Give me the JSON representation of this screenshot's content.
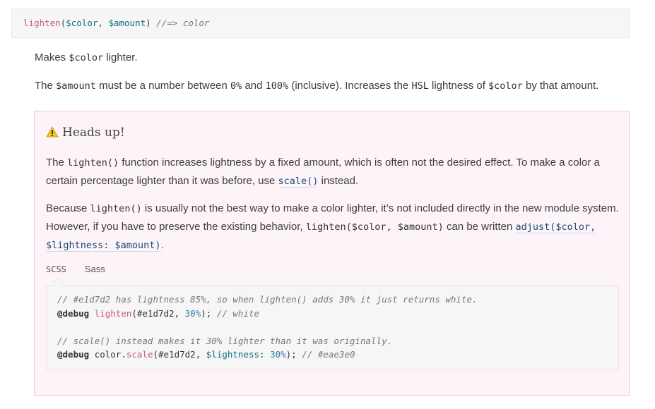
{
  "signature": {
    "fn": "lighten",
    "arg1": "$color",
    "arg2": "$amount",
    "returns": "//=> color"
  },
  "intro": {
    "p1_text": "Makes ",
    "p1_code": "$color",
    "p1_end": " lighter.",
    "p2": [
      {
        "t": "The "
      },
      {
        "c": "$amount"
      },
      {
        "t": " must be a number between "
      },
      {
        "c": "0%"
      },
      {
        "t": " and "
      },
      {
        "c": "100%"
      },
      {
        "t": " (inclusive). Increases the "
      },
      {
        "c": "HSL"
      },
      {
        "t": " lightness of "
      },
      {
        "c": "$color"
      },
      {
        "t": " by that amount."
      }
    ]
  },
  "callout": {
    "icon": "warning-icon",
    "title": "Heads up!",
    "para1": {
      "a": "The ",
      "code": "lighten()",
      "b": " function increases lightness by a fixed amount, which is often not the desired effect. To make a color a certain percentage lighter than it was before, use ",
      "link": "scale()",
      "c": " instead."
    },
    "para2": {
      "a": "Because ",
      "code1": "lighten()",
      "b": " is usually not the best way to make a color lighter, it’s not included directly in the new module system. However, if you have to preserve the existing behavior, ",
      "code2": "lighten($color, $amount)",
      "c": " can be written ",
      "link": "adjust($color, $lightness: $amount)",
      "d": "."
    },
    "tabs": [
      "SCSS",
      "Sass"
    ],
    "active_tab": "SCSS",
    "code": {
      "comment1": "// #e1d7d2 has lightness 85%, so when lighten() adds 30% it just returns white.",
      "l2_kw": "@debug",
      "l2_fn": "lighten",
      "l2_open": "(",
      "l2_color": "#e1d7d2",
      "l2_sep": ", ",
      "l2_num": "30%",
      "l2_close": "); ",
      "l2_cmt": "// white",
      "comment2": "// scale() instead makes it 30% lighter than it was originally.",
      "l5_kw": "@debug",
      "l5_mod": "color.",
      "l5_fn": "scale",
      "l5_open": "(",
      "l5_color": "#e1d7d2",
      "l5_sep": ", ",
      "l5_var": "$lightness",
      "l5_colon": ": ",
      "l5_num": "30%",
      "l5_close": "); ",
      "l5_cmt": "// #eae3e0"
    }
  }
}
